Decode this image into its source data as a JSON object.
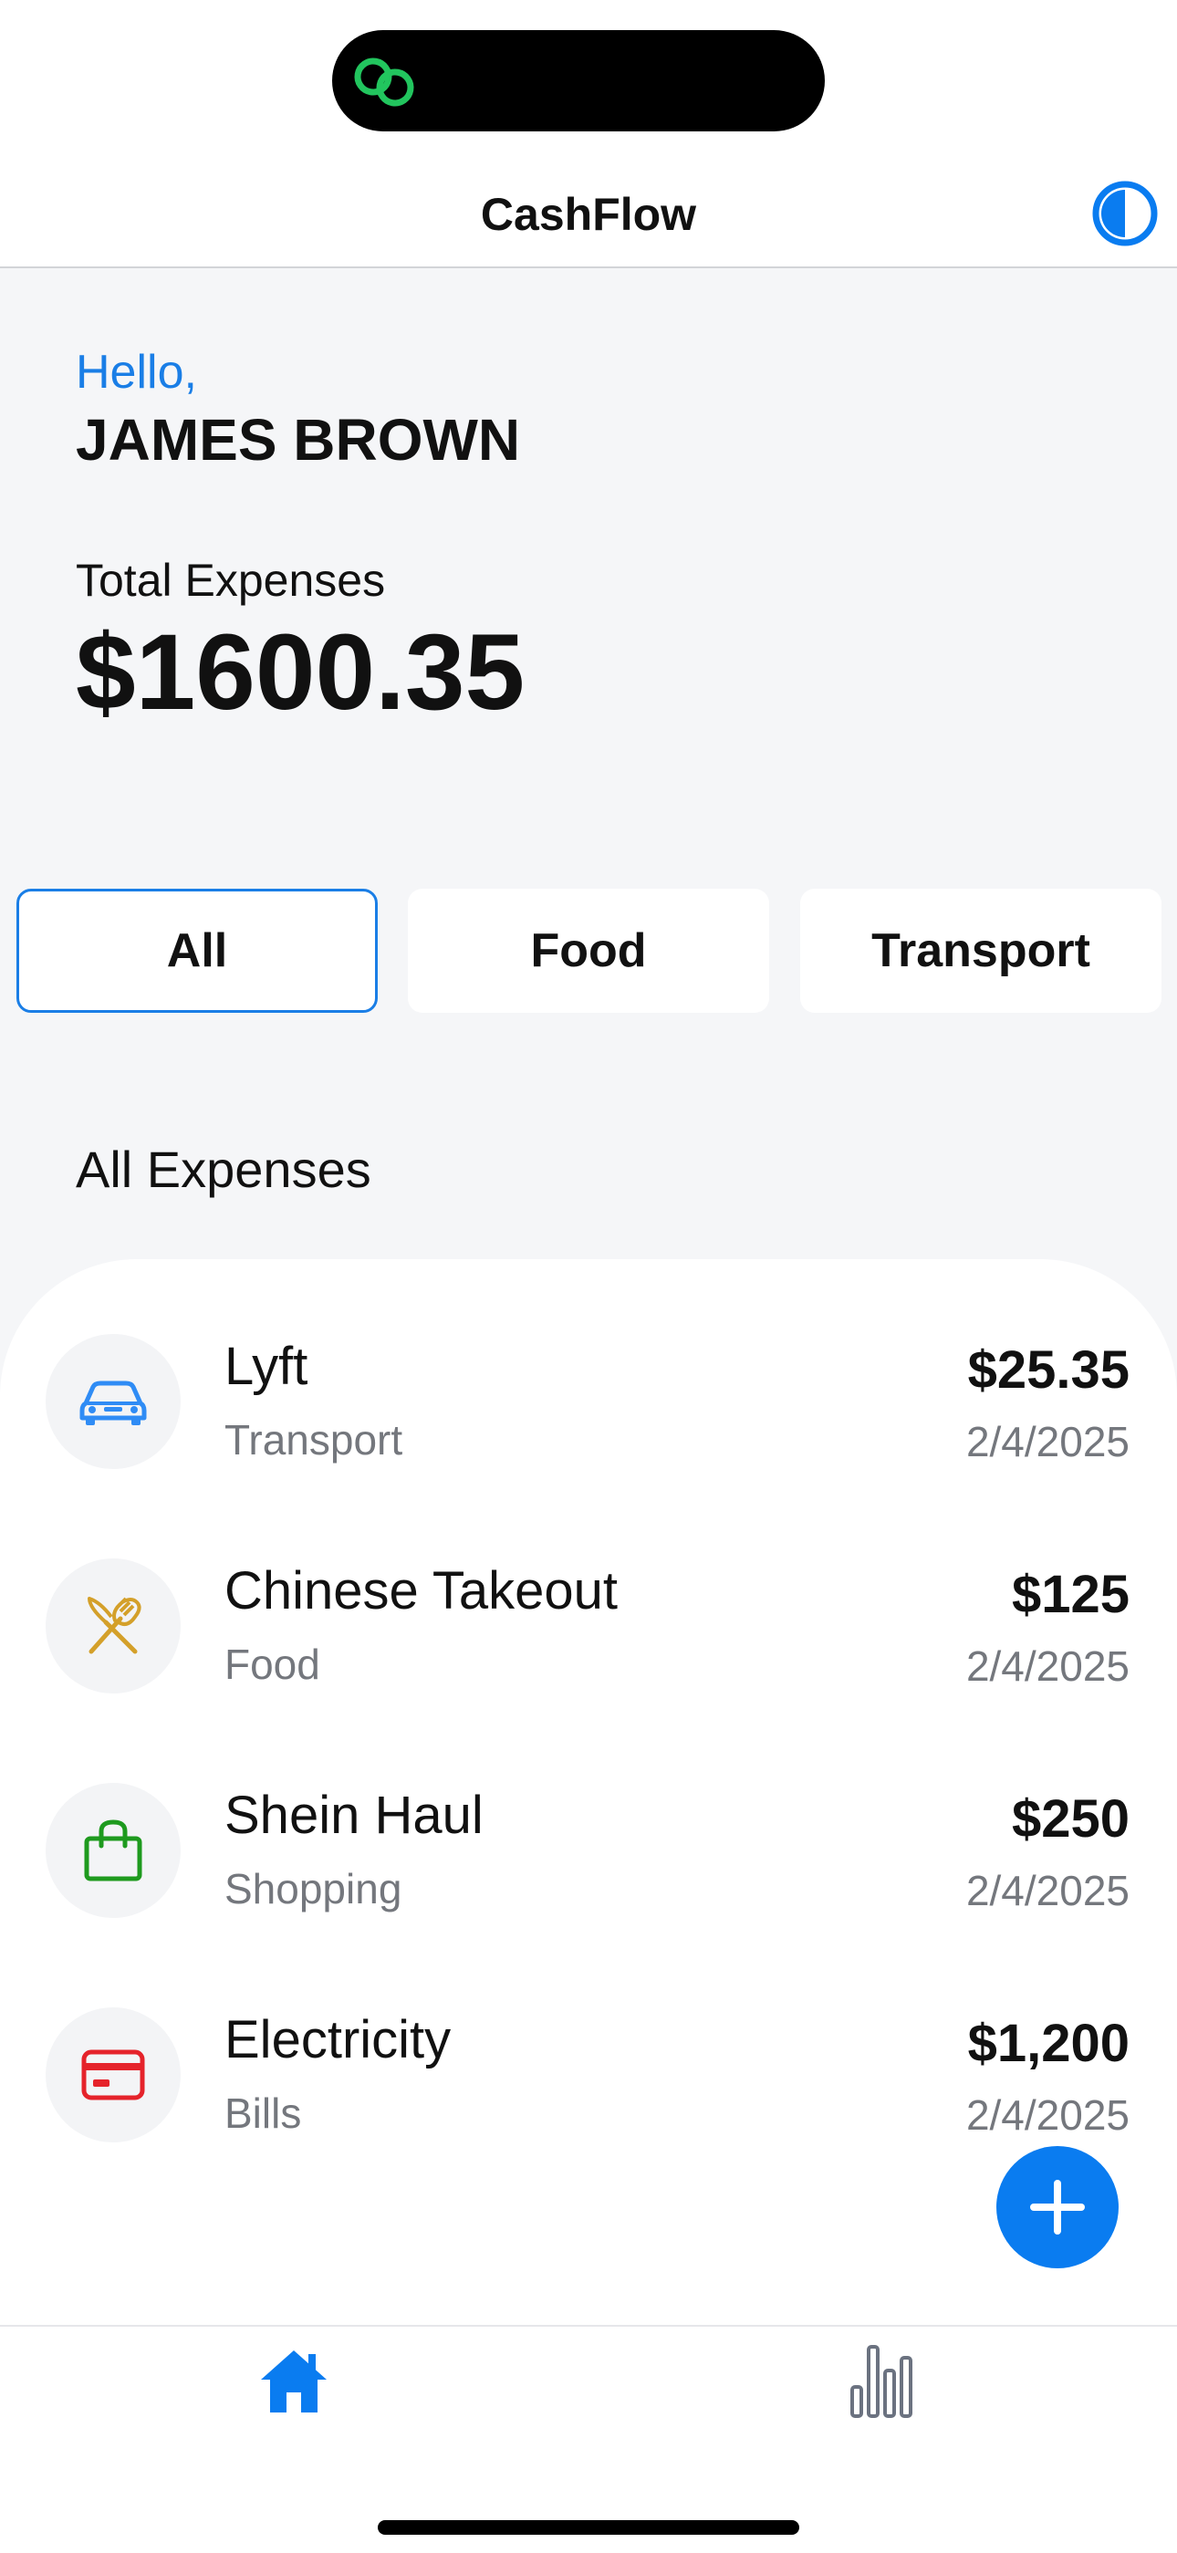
{
  "header": {
    "title": "CashFlow"
  },
  "greeting": {
    "hello": "Hello,",
    "name": "JAMES BROWN"
  },
  "summary": {
    "label": "Total Expenses",
    "total": "$1600.35"
  },
  "filters": [
    {
      "label": "All",
      "active": true
    },
    {
      "label": "Food",
      "active": false
    },
    {
      "label": "Transport",
      "active": false
    }
  ],
  "section_title": "All Expenses",
  "expenses": [
    {
      "title": "Lyft",
      "category": "Transport",
      "amount": "$25.35",
      "date": "2/4/2025",
      "icon": "car-icon",
      "color": "#2f8cf5"
    },
    {
      "title": "Chinese Takeout",
      "category": "Food",
      "amount": "$125",
      "date": "2/4/2025",
      "icon": "fork-knife-icon",
      "color": "#d4a02a"
    },
    {
      "title": "Shein Haul",
      "category": "Shopping",
      "amount": "$250",
      "date": "2/4/2025",
      "icon": "shopping-bag-icon",
      "color": "#1e9a1e"
    },
    {
      "title": "Electricity",
      "category": "Bills",
      "amount": "$1,200",
      "date": "2/4/2025",
      "icon": "credit-card-icon",
      "color": "#e5232b"
    }
  ],
  "nav": {
    "items": [
      "home-icon",
      "bar-chart-icon"
    ],
    "active": "home-icon"
  },
  "colors": {
    "accent": "#0a7cf0",
    "background": "#f5f6f8",
    "status_link": "#22c55e"
  }
}
